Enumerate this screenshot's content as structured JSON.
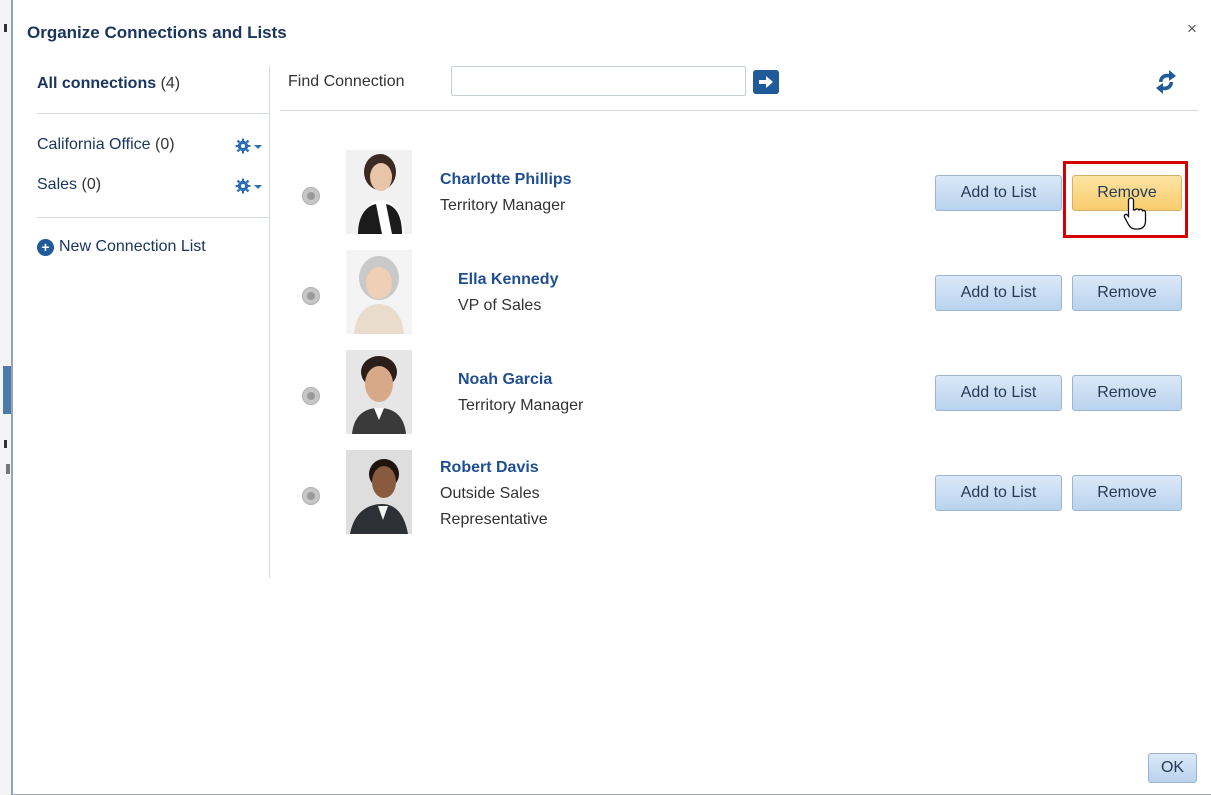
{
  "dialog": {
    "title": "Organize Connections and Lists",
    "close_label": "×"
  },
  "sidebar": {
    "all": {
      "label": "All connections",
      "count": "(4)"
    },
    "lists": [
      {
        "label": "California Office",
        "count": "(0)",
        "icon": "gear-icon"
      },
      {
        "label": "Sales",
        "count": "(0)",
        "icon": "gear-icon"
      }
    ],
    "new_list_label": "New Connection List"
  },
  "search": {
    "label": "Find Connection",
    "value": "",
    "placeholder": ""
  },
  "connections": [
    {
      "name": "Charlotte Phillips",
      "title_line1": "Territory Manager",
      "title_line2": "",
      "add_label": "Add to List",
      "remove_label": "Remove"
    },
    {
      "name": "Ella Kennedy",
      "title_line1": "VP of Sales",
      "title_line2": "",
      "add_label": "Add to List",
      "remove_label": "Remove"
    },
    {
      "name": "Noah Garcia",
      "title_line1": "Territory Manager",
      "title_line2": "",
      "add_label": "Add to List",
      "remove_label": "Remove"
    },
    {
      "name": "Robert Davis",
      "title_line1": "Outside Sales",
      "title_line2": "Representative",
      "add_label": "Add to List",
      "remove_label": "Remove"
    }
  ],
  "footer": {
    "ok_label": "OK"
  },
  "colors": {
    "link": "#1f4f91",
    "title": "#1a3660",
    "button_bg": "#c9ddf3",
    "button_hover_bg": "#fbd989",
    "highlight": "#d60000"
  }
}
